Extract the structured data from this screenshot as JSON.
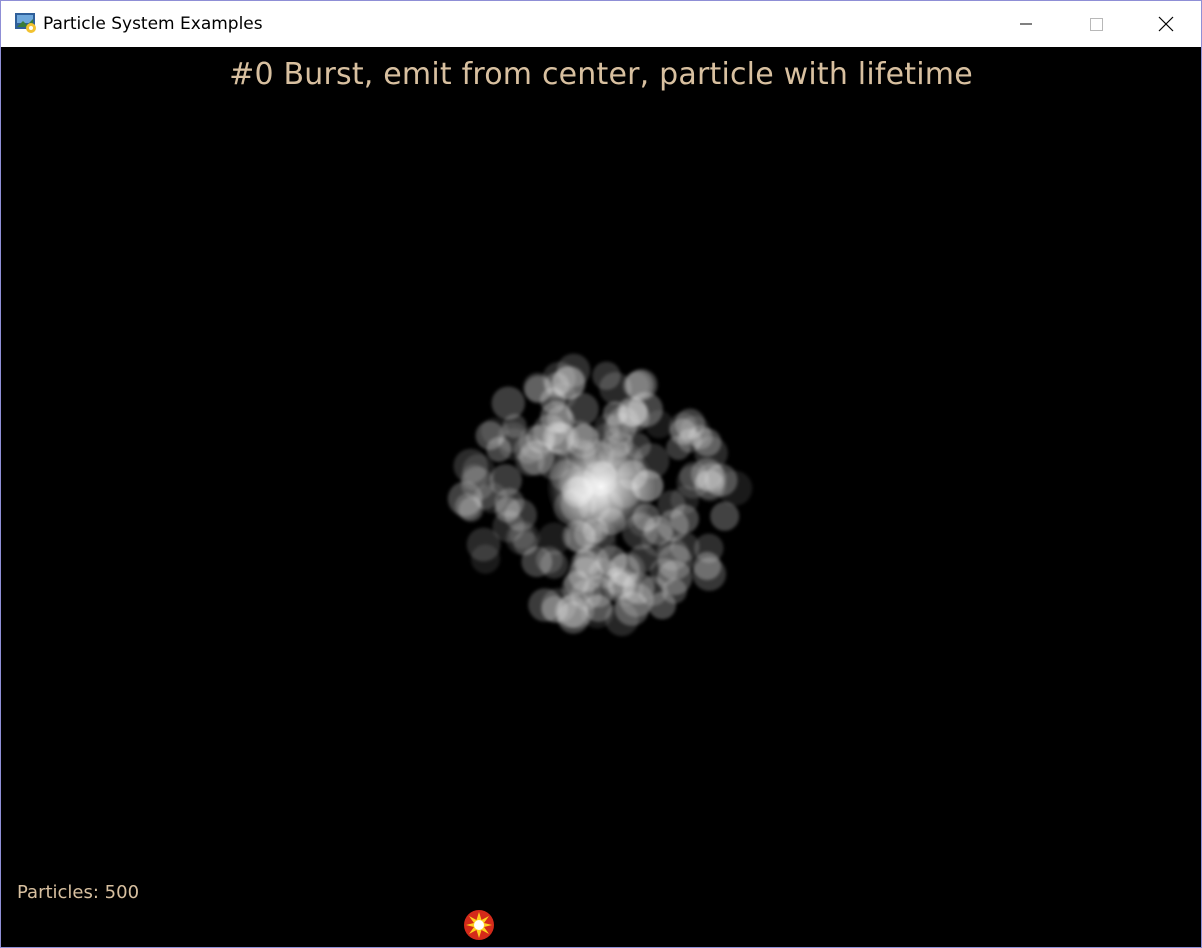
{
  "window": {
    "title": "Particle System Examples",
    "app_icon": "python-icon"
  },
  "controls": {
    "minimize": "minimize-icon",
    "maximize": "maximize-icon",
    "close": "close-icon"
  },
  "scene": {
    "demo_title": "#0 Burst, emit from center, particle with lifetime",
    "particle_count_label": "Particles: 500",
    "text_color": "#d8c0a0",
    "background": "#000000",
    "particle_color": "#ffffff",
    "cursor_icon": "burst-icon"
  }
}
